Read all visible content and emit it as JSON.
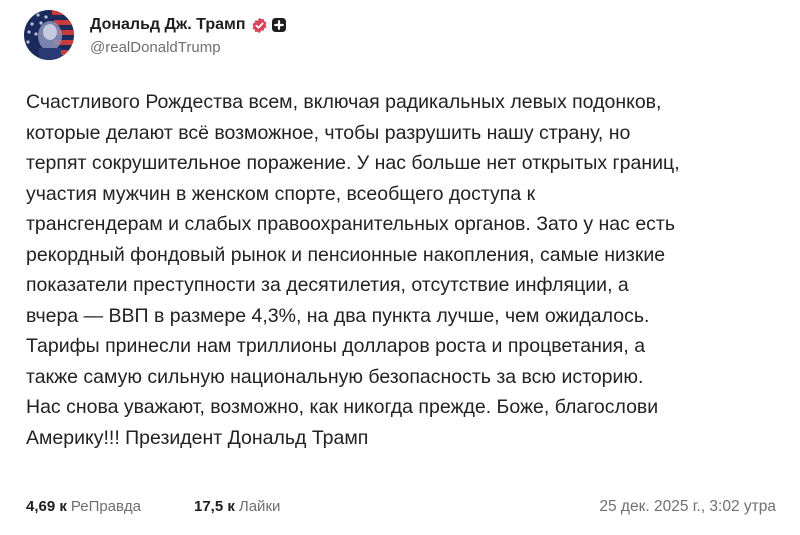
{
  "author": {
    "name": "Дональд Дж. Трамп",
    "handle": "@realDonaldTrump",
    "avatar_icon": "flag-portrait-avatar",
    "verified_icon": "verified-badge-icon",
    "extra_icon": "plus-square-icon"
  },
  "post": {
    "lines": [
      "Счастливого Рождества всем, включая радикальных левых подонков,",
      "которые делают всё возможное, чтобы разрушить нашу страну, но",
      "терпят сокрушительное поражение. У нас больше нет открытых границ,",
      "участия мужчин в женском спорте, всеобщего доступа к",
      "трансгендерам и слабых правоохранительных органов. Зато у нас есть",
      "рекордный фондовый рынок и пенсионные накопления, самые низкие",
      "показатели преступности за десятилетия, отсутствие инфляции, а",
      "вчера — ВВП в размере 4,3%, на два пункта лучше, чем ожидалось.",
      "Тарифы принесли нам триллионы долларов роста и процветания, а",
      "также самую сильную национальную безопасность за всю историю.",
      "Нас снова уважают, возможно, как никогда прежде. Боже, благослови",
      "Америку!!! Президент Дональд Трамп"
    ]
  },
  "footer": {
    "retruths_count": "4,69 к",
    "retruths_label": "РеПравда",
    "likes_count": "17,5 к",
    "likes_label": "Лайки",
    "timestamp": "25 дек. 2025 г., 3:02 утра"
  },
  "colors": {
    "verified": "#d6455a",
    "text": "#222222",
    "muted": "#6f6f6f"
  }
}
